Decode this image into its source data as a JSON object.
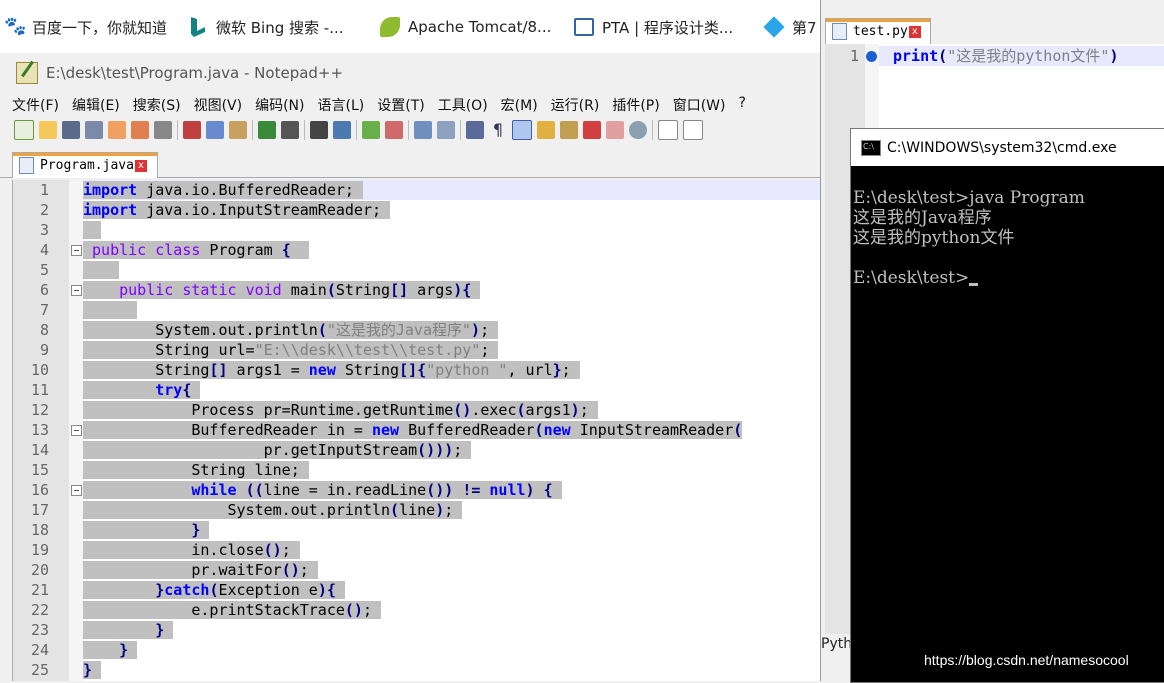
{
  "bookmarks": [
    {
      "label": "百度一下，你就知道",
      "icon": "baidu-paw-icon"
    },
    {
      "label": "微软 Bing 搜索 -...",
      "icon": "bing-icon"
    },
    {
      "label": "Apache Tomcat/8...",
      "icon": "tomcat-leaf-icon"
    },
    {
      "label": "PTA | 程序设计类...",
      "icon": "pta-monitor-icon"
    },
    {
      "label": "第7",
      "icon": "diamond-icon"
    }
  ],
  "npp": {
    "title": "E:\\desk\\test\\Program.java - Notepad++",
    "menu": [
      "文件(F)",
      "编辑(E)",
      "搜索(S)",
      "视图(V)",
      "编码(N)",
      "语言(L)",
      "设置(T)",
      "工具(O)",
      "宏(M)",
      "运行(R)",
      "插件(P)",
      "窗口(W)",
      "?"
    ],
    "tab": {
      "label": "Program.java",
      "close": "x"
    }
  },
  "code_lines": [
    {
      "n": "1",
      "html": "<span class='sel'><span class='kw'>import</span> java.io.BufferedReader; </span>"
    },
    {
      "n": "2",
      "html": "<span class='sel'><span class='kw'>import</span> java.io.InputStreamReader; </span>"
    },
    {
      "n": "3",
      "html": "<span class='sel'>  </span>"
    },
    {
      "n": "4",
      "html": "<span class='sel'> <span class='kw2'>public</span> <span class='kw2'>class</span> Program <span class='op'>{</span>  </span>"
    },
    {
      "n": "5",
      "html": "<span class='sel'>    </span>"
    },
    {
      "n": "6",
      "html": "<span class='sel'>    <span class='kw2'>public</span> <span class='kw2'>static</span> <span class='kw2'>void</span> main<span class='op'>(</span>String<span class='op'>[]</span> args<span class='op'>){</span> </span>"
    },
    {
      "n": "7",
      "html": "<span class='sel'>      </span>"
    },
    {
      "n": "8",
      "html": "<span class='sel'>        System.out.println<span class='op'>(</span><span class='str'>\"这是我的Java程序\"</span><span class='op'>)</span>; </span>"
    },
    {
      "n": "9",
      "html": "<span class='sel'>        String url=<span class='str'>\"E:\\\\desk\\\\test\\\\test.py\"</span>; </span>"
    },
    {
      "n": "10",
      "html": "<span class='sel'>        String<span class='op'>[]</span> args1 = <span class='kw'>new</span> String<span class='op'>[]{</span><span class='str'>\"python \"</span>, url<span class='op'>}</span>; </span>"
    },
    {
      "n": "11",
      "html": "<span class='sel'>        <span class='kw'>try</span><span class='op'>{</span> </span>"
    },
    {
      "n": "12",
      "html": "<span class='sel'>            Process pr=Runtime.getRuntime<span class='op'>()</span>.exec<span class='op'>(</span>args1<span class='op'>)</span>; </span>"
    },
    {
      "n": "13",
      "html": "<span class='sel'>            BufferedReader in = <span class='kw'>new</span> BufferedReader<span class='op'>(</span><span class='kw'>new</span> InputStreamReader<span class='op'>(</span></span>"
    },
    {
      "n": "14",
      "html": "<span class='sel'>                    pr.getInputStream<span class='op'>()))</span>; </span>"
    },
    {
      "n": "15",
      "html": "<span class='sel'>            String line; </span>"
    },
    {
      "n": "16",
      "html": "<span class='sel'>            <span class='kw'>while</span> <span class='op'>((</span>line = in.readLine<span class='op'>())</span> <span class='op'>!=</span> <span class='kw'>null</span><span class='op'>)</span> <span class='op'>{</span> </span>"
    },
    {
      "n": "17",
      "html": "<span class='sel'>                System.out.println<span class='op'>(</span>line<span class='op'>)</span>; </span>"
    },
    {
      "n": "18",
      "html": "<span class='sel'>            <span class='op'>}</span> </span>"
    },
    {
      "n": "19",
      "html": "<span class='sel'>            in.close<span class='op'>()</span>; </span>"
    },
    {
      "n": "20",
      "html": "<span class='sel'>            pr.waitFor<span class='op'>()</span>; </span>"
    },
    {
      "n": "21",
      "html": "<span class='sel'>        <span class='op'>}</span><span class='kw'>catch</span><span class='op'>(</span>Exception e<span class='op'>){</span> </span>"
    },
    {
      "n": "22",
      "html": "<span class='sel'>            e.printStackTrace<span class='op'>()</span>; </span>"
    },
    {
      "n": "23",
      "html": "<span class='sel'>        <span class='op'>}</span> </span>"
    },
    {
      "n": "24",
      "html": "<span class='sel'>    <span class='op'>}</span> </span>"
    },
    {
      "n": "25",
      "html": "<span class='sel'><span class='op'>}</span> </span>"
    }
  ],
  "py": {
    "tab": {
      "label": "test.py",
      "close": "x"
    },
    "line_no": "1",
    "code_html": "<span class='kw'>print</span><span class='op'>(</span><span class='str'>\"这是我的python文件\"</span><span class='op'>)</span>",
    "status": "Pyth"
  },
  "cmd": {
    "title": "C:\\WINDOWS\\system32\\cmd.exe",
    "lines": [
      "E:\\desk\\test>java Program",
      "这是我的Java程序",
      "这是我的python文件",
      "",
      "E:\\desk\\test>"
    ]
  },
  "watermark": "https://blog.csdn.net/namesocool"
}
